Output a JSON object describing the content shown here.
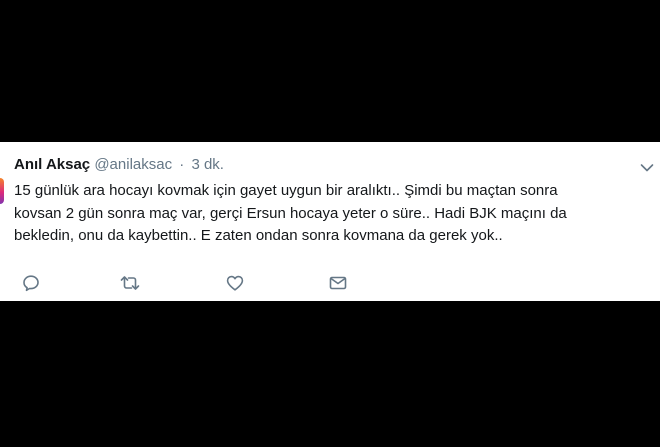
{
  "tweet": {
    "author_name": "Anıl Aksaç",
    "author_handle": "@anilaksac",
    "separator": "·",
    "timestamp": "3 dk.",
    "text_lines": [
      "15 günlük ara hocayı kovmak için gayet uygun bir aralıktı.. Şimdi bu maçtan sonra",
      "kovsan 2 gün sonra maç var, gerçi Ersun hocaya yeter o süre.. Hadi BJK maçını da",
      "bekledin, onu da kaybettin.. E zaten ondan sonra kovmana da gerek yok.."
    ]
  },
  "icons": {
    "caret": "chevron-down-icon",
    "reply": "reply-icon",
    "retweet": "retweet-icon",
    "like": "heart-icon",
    "dm": "envelope-icon"
  },
  "colors": {
    "background": "#000000",
    "card": "#ffffff",
    "text_primary": "#14171a",
    "text_secondary": "#657786",
    "icon": "#657786"
  }
}
